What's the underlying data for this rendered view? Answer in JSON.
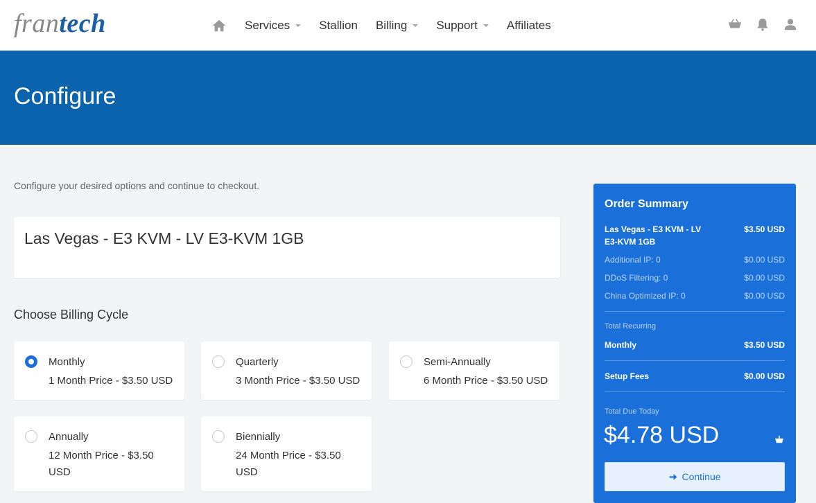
{
  "brand": {
    "part1": "fran",
    "part2": "tech"
  },
  "nav": {
    "items": [
      {
        "label": "Services",
        "dropdown": true
      },
      {
        "label": "Stallion",
        "dropdown": false
      },
      {
        "label": "Billing",
        "dropdown": true
      },
      {
        "label": "Support",
        "dropdown": true
      },
      {
        "label": "Affiliates",
        "dropdown": false
      }
    ]
  },
  "header_icons": [
    "home-icon",
    "cart-icon",
    "bell-icon",
    "user-icon"
  ],
  "banner": {
    "title": "Configure"
  },
  "main": {
    "intro": "Configure your desired options and continue to checkout.",
    "product_name": "Las Vegas - E3 KVM - LV E3-KVM 1GB",
    "billing_title": "Choose Billing Cycle",
    "cycles": [
      {
        "label": "Monthly",
        "price": "1 Month Price - $3.50 USD",
        "selected": true
      },
      {
        "label": "Quarterly",
        "price": "3 Month Price - $3.50 USD",
        "selected": false
      },
      {
        "label": "Semi-Annually",
        "price": "6 Month Price - $3.50 USD",
        "selected": false
      },
      {
        "label": "Annually",
        "price": "12 Month Price - $3.50 USD",
        "selected": false
      },
      {
        "label": "Biennially",
        "price": "24 Month Price - $3.50 USD",
        "selected": false
      }
    ]
  },
  "summary": {
    "title": "Order Summary",
    "lines": [
      {
        "label": "Las Vegas - E3 KVM - LV E3-KVM 1GB",
        "value": "$3.50 USD"
      },
      {
        "label": "Additional IP: 0",
        "value": "$0.00 USD"
      },
      {
        "label": "DDoS Filtering: 0",
        "value": "$0.00 USD"
      },
      {
        "label": "China Optimized IP: 0",
        "value": "$0.00 USD"
      }
    ],
    "total_recurring_label": "Total Recurring",
    "recurring": {
      "label": "Monthly",
      "value": "$3.50 USD"
    },
    "setup": {
      "label": "Setup Fees",
      "value": "$0.00 USD"
    },
    "total_due_label": "Total Due Today",
    "total_due": "$4.78 USD",
    "continue_label": "Continue"
  },
  "colors": {
    "banner": "#0b63ad",
    "summary": "#1b6fd8",
    "brand_blue": "#1b5ea6"
  }
}
